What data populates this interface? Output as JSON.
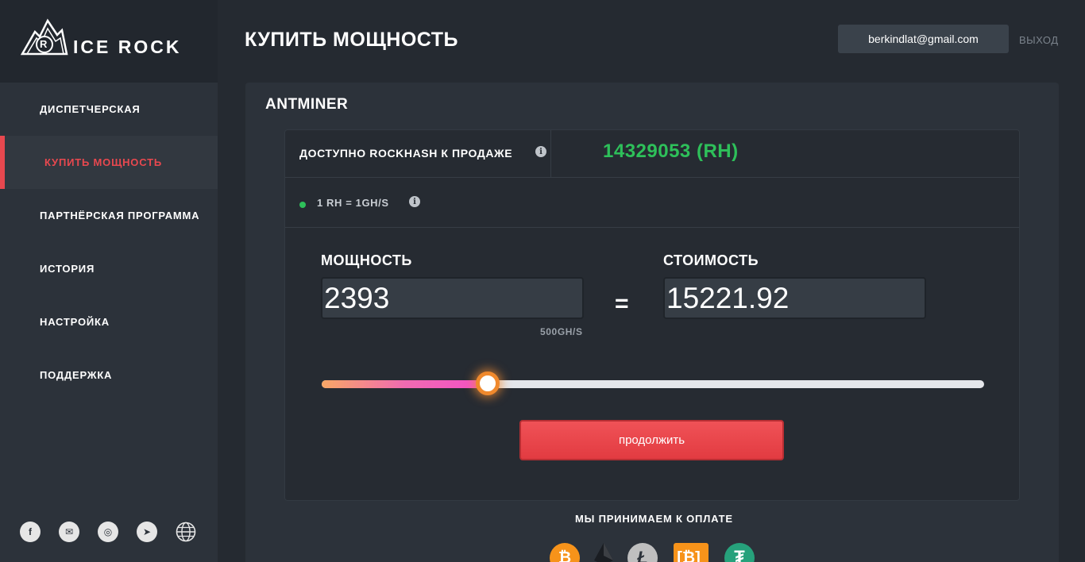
{
  "brand": {
    "name": "ICE ROCK",
    "logo_letter": "R"
  },
  "sidebar": {
    "items": [
      {
        "label": "ДИСПЕТЧЕРСКАЯ"
      },
      {
        "label": "КУПИТЬ МОЩНОСТЬ",
        "active": true
      },
      {
        "label": "ПАРТНЁРСКАЯ ПРОГРАММА"
      },
      {
        "label": "ИСТОРИЯ"
      },
      {
        "label": "НАСТРОЙКА"
      },
      {
        "label": "ПОДДЕРЖКА"
      }
    ],
    "socials": [
      {
        "icon": "facebook-icon",
        "glyph": "f"
      },
      {
        "icon": "mail-icon",
        "glyph": "✉"
      },
      {
        "icon": "instagram-icon",
        "glyph": "◎"
      },
      {
        "icon": "telegram-icon",
        "glyph": "➤"
      },
      {
        "icon": "globe-icon",
        "glyph": ""
      }
    ]
  },
  "header": {
    "title": "КУПИТЬ МОЩНОСТЬ",
    "email": "berkindlat@gmail.com",
    "logout_label": "ВЫХОД"
  },
  "panel": {
    "title": "ANTMINER",
    "available_label": "ДОСТУПНО ROCKHASH К ПРОДАЖЕ",
    "available_value": "14329053 (RH)",
    "rate_label": "1 RH = 1GH/S",
    "power_label": "МОЩНОСТЬ",
    "power_value": "2393",
    "cost_label": "СТОИМОСТЬ",
    "cost_value": "15221.92",
    "equals_sign": "=",
    "unit_hint": "500GH/S",
    "slider_level": 0.25,
    "continue_label": "продолжить",
    "payment_label": "МЫ ПРИНИМАЕМ К ОПЛАТЕ",
    "payment_coins": [
      "bitcoin-icon",
      "ethereum-icon",
      "litecoin-icon",
      "bitcoin-cash-icon",
      "tether-icon"
    ]
  },
  "colors": {
    "accent_red": "#e8484f",
    "available_green": "#2ec05a",
    "slider_thumb": "#f0892d"
  }
}
